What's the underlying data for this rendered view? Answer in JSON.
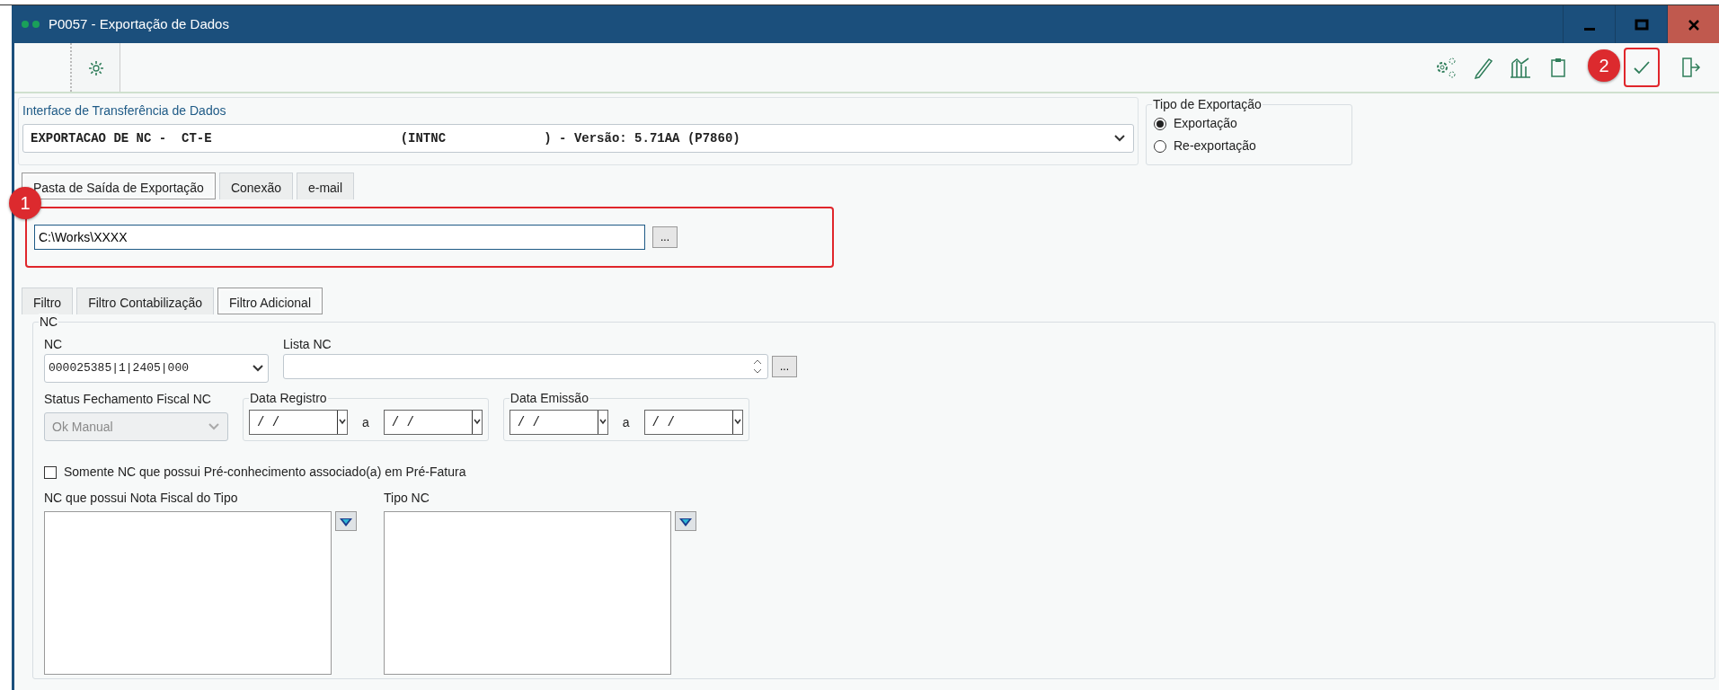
{
  "window": {
    "title": "P0057 - Exportação de Dados"
  },
  "interface": {
    "label": "Interface de Transferência de Dados",
    "value": "EXPORTACAO DE NC -  CT-E                         (INTNC             ) - Versão: 5.71AA (P7860)"
  },
  "export_type": {
    "legend": "Tipo de Exportação",
    "options": [
      {
        "label": "Exportação",
        "selected": true
      },
      {
        "label": "Re-exportação",
        "selected": false
      }
    ]
  },
  "output_tabs": [
    {
      "label": "Pasta de Saída de Exportação",
      "selected": true
    },
    {
      "label": "Conexão",
      "selected": false
    },
    {
      "label": "e-mail",
      "selected": false
    }
  ],
  "output_folder": {
    "value": "C:\\Works\\XXXX",
    "browse": "..."
  },
  "filter_tabs": [
    {
      "label": "Filtro",
      "selected": false
    },
    {
      "label": "Filtro Contabilização",
      "selected": false
    },
    {
      "label": "Filtro Adicional",
      "selected": true
    }
  ],
  "nc_group": {
    "legend": "NC",
    "nc": {
      "label": "NC",
      "value": "000025385|1|2405|000"
    },
    "lista_nc": {
      "label": "Lista NC",
      "browse": "..."
    },
    "status": {
      "label": "Status Fechamento Fiscal NC",
      "value": "Ok Manual",
      "disabled": true
    },
    "date_ranges": [
      {
        "legend": "Data Registro",
        "from": "/ /",
        "separator": "a",
        "to": "/ /"
      },
      {
        "legend": "Data Emissão",
        "from": "/ /",
        "separator": "a",
        "to": "/ /"
      }
    ],
    "only_pre_invoice": {
      "label": "Somente NC que possui Pré-conhecimento associado(a) em Pré-Fatura",
      "checked": false
    },
    "lists": [
      {
        "label": "NC que possui Nota Fiscal do Tipo"
      },
      {
        "label": "Tipo NC"
      }
    ]
  },
  "callouts": [
    {
      "number": "1"
    },
    {
      "number": "2"
    }
  ]
}
